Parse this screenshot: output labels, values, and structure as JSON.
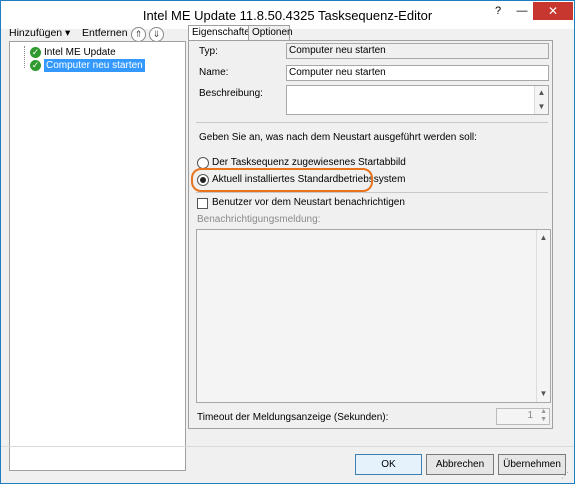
{
  "window": {
    "title": "Intel ME Update 11.8.50.4325 Tasksequenz-Editor",
    "help_icon": "?",
    "min_icon": "—",
    "close_icon": "✕"
  },
  "toolbar": {
    "add_label": "Hinzufügen",
    "add_arrow": "▾",
    "remove_label": "Entfernen",
    "up_icon": "⇑",
    "down_icon": "⇓"
  },
  "tree": {
    "items": [
      {
        "label": "Intel ME Update",
        "status_icon": "check-icon"
      },
      {
        "label": "Computer neu starten",
        "status_icon": "check-icon",
        "selected": true
      }
    ],
    "check_glyph": "✓"
  },
  "tabs": [
    {
      "label": "Eigenschaften",
      "active": true
    },
    {
      "label": "Optionen",
      "active": false
    }
  ],
  "properties": {
    "type_label": "Typ:",
    "type_value": "Computer neu starten",
    "name_label": "Name:",
    "name_value": "Computer neu starten",
    "description_label": "Beschreibung:",
    "description_value": ""
  },
  "restart": {
    "question": "Geben Sie an, was nach dem Neustart ausgeführt werden soll:",
    "options": [
      {
        "label": "Der Tasksequenz zugewiesenes Startabbild",
        "selected": false
      },
      {
        "label": "Aktuell installiertes Standardbetriebssystem",
        "selected": true
      }
    ],
    "notify_label": "Benutzer vor dem Neustart benachrichtigen",
    "notify_checked": false,
    "message_label": "Benachrichtigungsmeldung:",
    "message_value": "",
    "timeout_label": "Timeout der Meldungsanzeige (Sekunden):",
    "timeout_value": "1"
  },
  "buttons": {
    "ok": "OK",
    "cancel": "Abbrechen",
    "apply": "Übernehmen"
  },
  "colors": {
    "highlight": "#e8731f",
    "selection": "#3399ff",
    "close_button": "#c7372f"
  }
}
